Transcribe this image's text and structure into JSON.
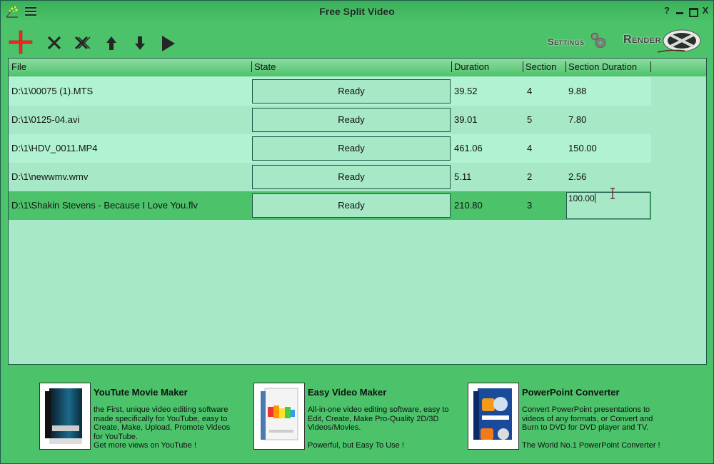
{
  "window": {
    "title": "Free Split Video",
    "controls": {
      "help": "?",
      "minimize": "minimize",
      "maximize": "maximize",
      "close": "X"
    }
  },
  "toolbar": {
    "buttons": [
      {
        "name": "add",
        "icon": "plus-icon",
        "color": "#e02020"
      },
      {
        "name": "remove",
        "icon": "x-icon"
      },
      {
        "name": "remove-all",
        "icon": "double-x-icon"
      },
      {
        "name": "move-up",
        "icon": "arrow-up-icon"
      },
      {
        "name": "move-down",
        "icon": "arrow-down-icon"
      },
      {
        "name": "play",
        "icon": "play-icon"
      }
    ],
    "settings_label": "Settings",
    "render_label": "Render"
  },
  "grid": {
    "columns": [
      "File",
      "State",
      "Duration",
      "Section",
      "Section Duration"
    ],
    "rows": [
      {
        "file": "D:\\1\\00075 (1).MTS",
        "state": "Ready",
        "duration": "39.52",
        "section": "4",
        "section_duration": "9.88"
      },
      {
        "file": "D:\\1\\0125-04.avi",
        "state": "Ready",
        "duration": "39.01",
        "section": "5",
        "section_duration": "7.80"
      },
      {
        "file": "D:\\1\\HDV_0011.MP4",
        "state": "Ready",
        "duration": "461.06",
        "section": "4",
        "section_duration": "150.00"
      },
      {
        "file": "D:\\1\\newwmv.wmv",
        "state": "Ready",
        "duration": "5.11",
        "section": "2",
        "section_duration": "2.56"
      },
      {
        "file": "D:\\1\\Shakin Stevens - Because I Love You.flv",
        "state": "Ready",
        "duration": "210.80",
        "section": "3",
        "section_duration": "100.00",
        "selected": true,
        "editing": true
      }
    ]
  },
  "promos": [
    {
      "title": "YouTute Movie Maker",
      "description": "the First, unique video editing software\nmade specifically for YouTube, easy to\nCreate, Make, Upload, Promote Videos\nfor YouTube.\nGet more views on YouTube !"
    },
    {
      "title": "Easy Video Maker",
      "description": "All-in-one video editing software, easy to\nEdit, Create, Make Pro-Quality 2D/3D\nVideos/Movies.\n\nPowerful, but Easy To Use !"
    },
    {
      "title": "PowerPoint Converter",
      "description": "Convert PowerPoint presentations to\nvideos of any formats, or Convert and\nBurn to DVD for DVD player and TV.\n\nThe World No.1 PowerPoint Converter !"
    }
  ],
  "colors": {
    "window_bg": "#4cc36a",
    "row_odd": "#b0f2d1",
    "row_even": "#a7e8c6",
    "row_selected": "#4cc36a",
    "border": "#1f5a48"
  }
}
